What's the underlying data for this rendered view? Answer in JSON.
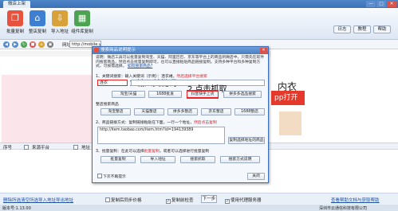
{
  "app": {
    "tab_title": "微店上架",
    "window_buttons": [
      "—",
      "□",
      "✕"
    ]
  },
  "toolbar": {
    "buttons": [
      {
        "label": "批量复制",
        "icon": "copy-icon",
        "color": "#e8533f"
      },
      {
        "label": "整店复制",
        "icon": "store-copy-icon",
        "color": "#3f7fd1"
      },
      {
        "label": "导入地址",
        "icon": "import-icon",
        "color": "#d9a13a"
      },
      {
        "label": "组件库复制",
        "icon": "component-icon",
        "color": "#4da352"
      }
    ],
    "right_buttons": [
      "日志",
      "教程",
      "帮助"
    ]
  },
  "addressbar": {
    "nav_icons": [
      "back-icon",
      "forward-icon",
      "refresh-icon",
      "stop-icon",
      "home-icon",
      "cart-icon"
    ],
    "label": "网址",
    "url": "http://mobile.yangkeduo.com"
  },
  "webpage": {
    "right_title": "内衣",
    "right_red": "pp打开"
  },
  "table": {
    "headers": [
      "序号",
      "",
      "来源平台",
      "",
      "地址"
    ]
  },
  "bottom": {
    "links": [
      "删除所选",
      "清空所选",
      "导入地址",
      "导出地址"
    ],
    "options": [
      "复制后同步价格",
      "复制前检查",
      "使用代理服务器"
    ],
    "buttons": [
      "下一步"
    ],
    "right_link": "查看帮助文档与获取帮助"
  },
  "status": {
    "version": "版本号:1.13.00",
    "company": "深圳市云通信科技有限公司"
  },
  "dialog": {
    "title": "搜索商品说明提示",
    "description": "说明：微店工具可以批量复制淘宝、天猫、阿里巴巴、京东等平台上的商品到微店中，只需先在软件内搜索商品，然后点击批量复制即可，也可以直接粘贴商品链接复制。支持多种平台和多种复制方式，可按需选择。",
    "desc_link": "如何搜索商品?",
    "step1": "1、关键词搜索：输入关键词（示例）：连衣裙，",
    "step1_red": "然后选择平台搜索",
    "input_value": "连衣",
    "annot1": "1.输入关键词",
    "annot2": "2.点击抓取",
    "row1": [
      "淘宝/天猫",
      "1688批发",
      "抖音快手上货",
      "拼多多选品搜索"
    ],
    "section2": "整店搜索商品",
    "row2": [
      "淘宝整店",
      "天猫整店",
      "拼多多整店",
      "京东整店",
      "1688整店"
    ],
    "step2": "2、商品链接方式：复制链接粘贴在下面，一行一个地址，",
    "step2_red": "然后点击复制",
    "area_text": "http://item.taobao.com/item.htm?id=194139389",
    "area_button": "复制选择地址的商品",
    "step3": "3、批量复制：在此可以选择",
    "step3_red": "批量复制",
    "step3_tail": "，或者可以选择进行批量复制",
    "row3": [
      "批量复制",
      "导入地址",
      "搜索抓取",
      "搜索方式说明"
    ],
    "footer_check": "下次不再提示",
    "close_button": "关闭"
  }
}
